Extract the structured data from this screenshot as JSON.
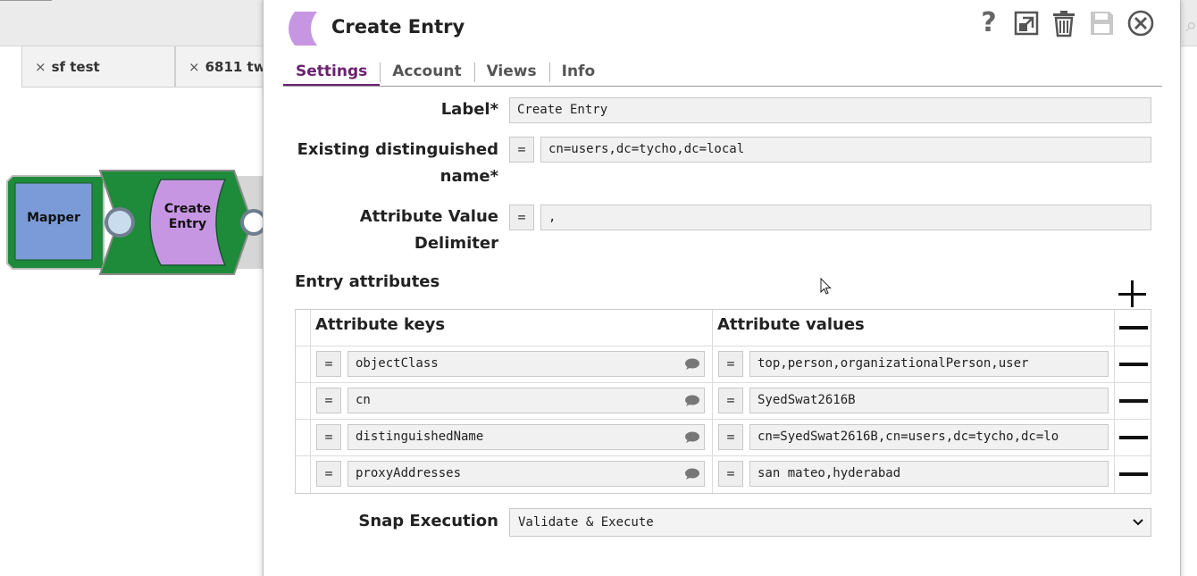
{
  "background": {
    "tabs": [
      {
        "close": "×",
        "label": "sf test"
      },
      {
        "close": "×",
        "label": "6811 tw"
      }
    ],
    "pipeline": {
      "snaps": [
        {
          "label": "Mapper",
          "color": "#7b9bd8"
        },
        {
          "label": "Create Entry",
          "color": "#c796e3"
        }
      ],
      "pipe_color": "#1e8b3a"
    }
  },
  "dialog": {
    "title": "Create Entry",
    "title_icon_color": "#c796e3",
    "header_icons": [
      "help-icon",
      "expand-icon",
      "trash-icon",
      "save-icon",
      "close-circle-icon"
    ],
    "help_glyph": "?",
    "tabs": [
      {
        "label": "Settings",
        "active": true
      },
      {
        "label": "Account",
        "active": false
      },
      {
        "label": "Views",
        "active": false
      },
      {
        "label": "Info",
        "active": false
      }
    ],
    "accent_color": "#6b2270",
    "fields": {
      "label": {
        "label": "Label*",
        "value": "Create Entry"
      },
      "dn": {
        "label_line1": "Existing distinguished",
        "label_line2": "name*",
        "expr": "=",
        "value": "cn=users,dc=tycho,dc=local"
      },
      "delimiter": {
        "label_line1": "Attribute Value",
        "label_line2": "Delimiter",
        "expr": "=",
        "value": ","
      }
    },
    "entry_attributes": {
      "title": "Entry attributes",
      "columns": [
        "Attribute keys",
        "Attribute values"
      ],
      "rows": [
        {
          "key": "objectClass",
          "value": "top,person,organizationalPerson,user"
        },
        {
          "key": "cn",
          "value": "SyedSwat2616B"
        },
        {
          "key": "distinguishedName",
          "value": "cn=SyedSwat2616B,cn=users,dc=tycho,dc=lo"
        },
        {
          "key": "proxyAddresses",
          "value": "san mateo,hyderabad"
        }
      ],
      "expr": "="
    },
    "snap_execution": {
      "label": "Snap Execution",
      "value": "Validate & Execute"
    }
  }
}
